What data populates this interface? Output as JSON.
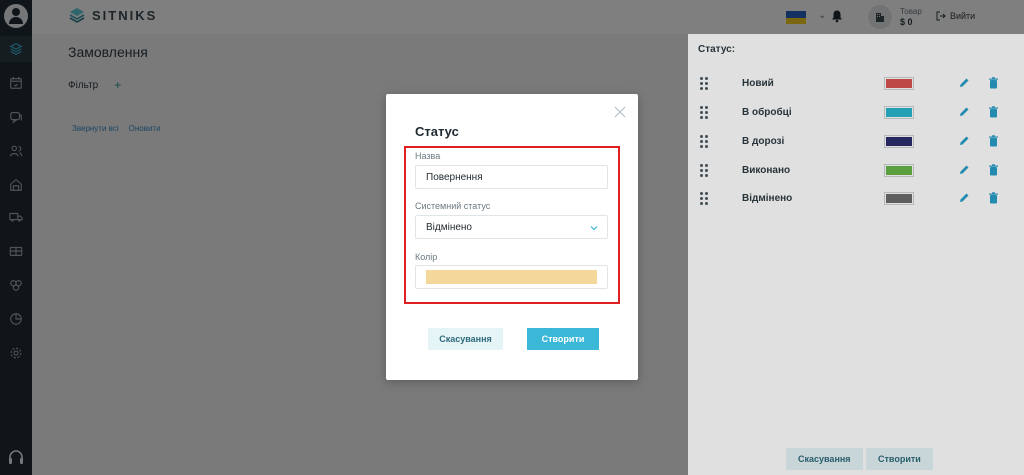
{
  "app": {
    "brand": "SITNIKS"
  },
  "header": {
    "goods_label": "Товар",
    "goods_value": "$ 0",
    "logout_label": "Вийти"
  },
  "page": {
    "title": "Замовлення",
    "filter_label": "Фільтр",
    "collapse_label": "Звернути всі",
    "refresh_label": "Оновити"
  },
  "status_panel": {
    "title": "Статус:",
    "statuses": [
      {
        "name": "Новий",
        "color": "#d9534f"
      },
      {
        "name": "В обробці",
        "color": "#2bb6cf"
      },
      {
        "name": "В дорозі",
        "color": "#2c2c6e"
      },
      {
        "name": "Виконано",
        "color": "#69b548"
      },
      {
        "name": "Відмінено",
        "color": "#6b6b6b"
      }
    ],
    "cancel_label": "Скасування",
    "create_label": "Створити"
  },
  "modal": {
    "title": "Статус",
    "name_label": "Назва",
    "name_value": "Повернення",
    "system_status_label": "Системний статус",
    "system_status_value": "Відмінено",
    "color_label": "Колір",
    "color_value": "#f3d79b",
    "cancel_label": "Скасування",
    "create_label": "Створити"
  },
  "colors": {
    "accent": "#3bb7d8",
    "sidebar": "#1f2a30",
    "highlight": "#e02020"
  }
}
